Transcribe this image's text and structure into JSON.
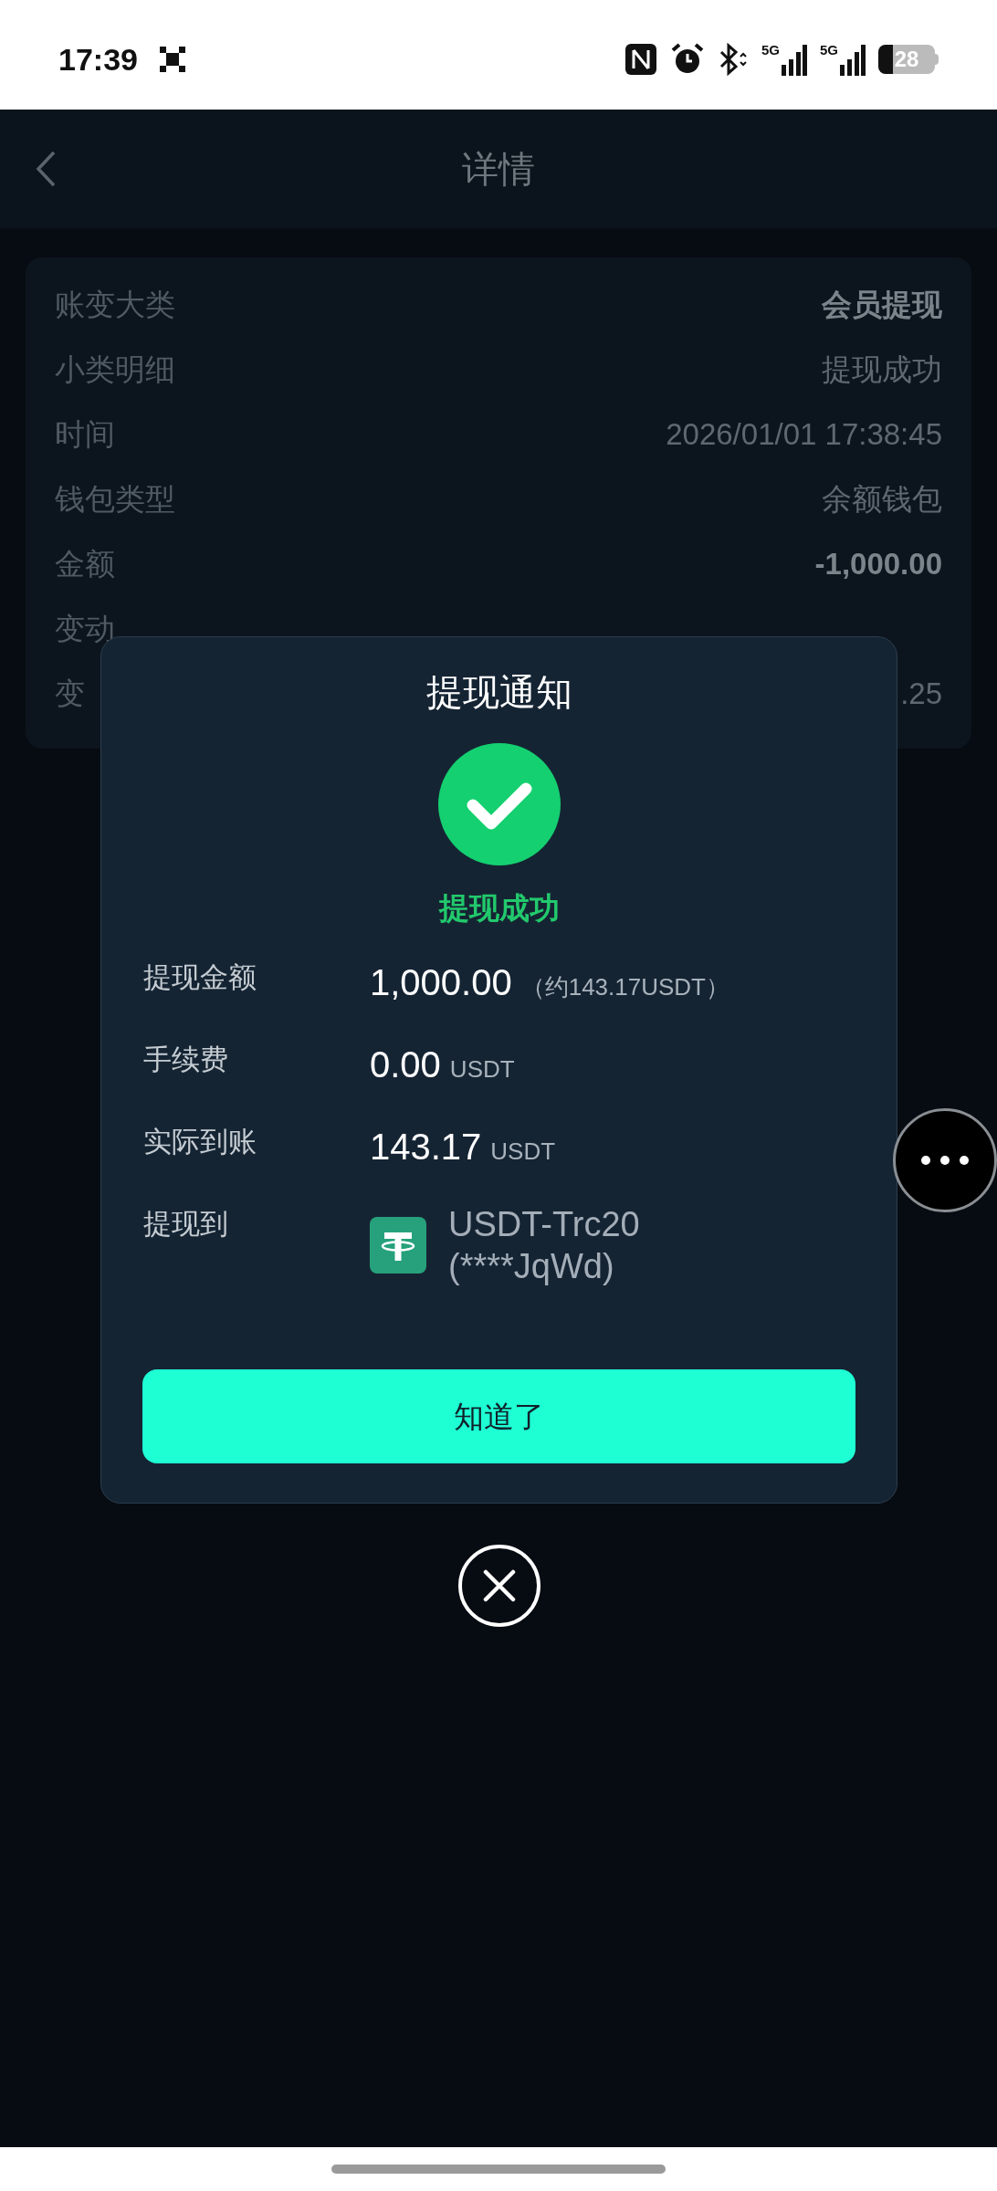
{
  "status_bar": {
    "time": "17:39",
    "network_labels": [
      "5G",
      "5G"
    ],
    "battery": "28"
  },
  "header": {
    "title": "详情"
  },
  "details": [
    {
      "label": "账变大类",
      "value": "会员提现",
      "bold": true
    },
    {
      "label": "小类明细",
      "value": "提现成功",
      "bold": false
    },
    {
      "label": "时间",
      "value": "2026/01/01 17:38:45",
      "bold": false
    },
    {
      "label": "钱包类型",
      "value": "余额钱包",
      "bold": false
    },
    {
      "label": "金额",
      "value": "-1,000.00",
      "bold": true
    },
    {
      "label": "变动"
    },
    {
      "label": "变",
      "value": ".25",
      "bold": false
    }
  ],
  "modal": {
    "title": "提现通知",
    "status": "提现成功",
    "rows": [
      {
        "kind": "amount",
        "label": "提现金额",
        "value": "1,000.00",
        "unit": "（约143.17USDT）"
      },
      {
        "kind": "amount",
        "label": "手续费",
        "value": "0.00",
        "unit": "USDT"
      },
      {
        "kind": "amount",
        "label": "实际到账",
        "value": "143.17",
        "unit": "USDT"
      },
      {
        "kind": "wallet",
        "label": "提现到",
        "lines": [
          "USDT-Trc20",
          "(****JqWd)"
        ]
      }
    ],
    "button": "知道了"
  }
}
